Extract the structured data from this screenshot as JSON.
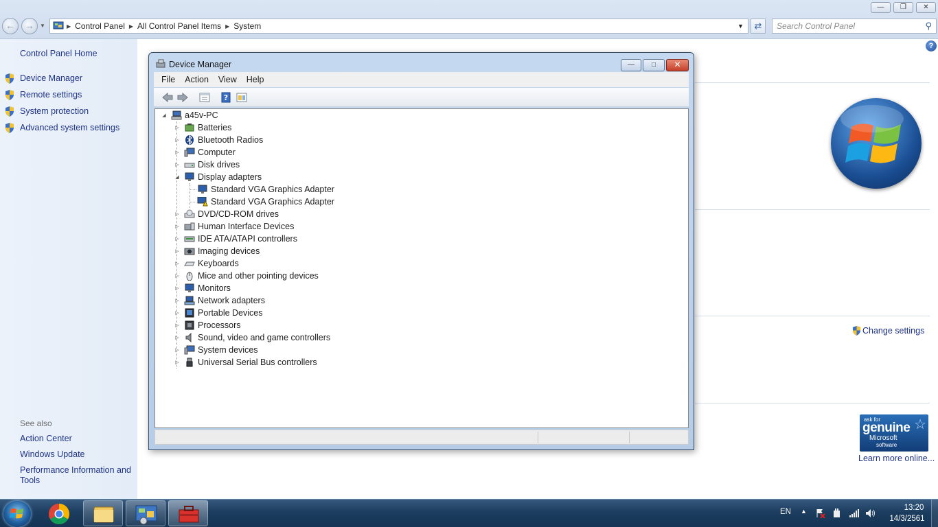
{
  "address": {
    "crumbs": [
      "Control Panel",
      "All Control Panel Items",
      "System"
    ]
  },
  "search": {
    "placeholder": "Search Control Panel"
  },
  "left_pane": {
    "home": "Control Panel Home",
    "tasks": [
      "Device Manager",
      "Remote settings",
      "System protection",
      "Advanced system settings"
    ],
    "see_also_title": "See also",
    "see_also": [
      "Action Center",
      "Windows Update",
      "Performance Information and Tools"
    ]
  },
  "right_pane": {
    "change_settings": "Change settings",
    "learn_more": "Learn more online...",
    "genuine": {
      "line1": "ask for",
      "line2": "genuine",
      "line3": "Microsoft",
      "line4": "software"
    }
  },
  "device_manager": {
    "title": "Device Manager",
    "menu": [
      "File",
      "Action",
      "View",
      "Help"
    ],
    "tree": [
      {
        "label": "a45v-PC",
        "level": 0,
        "expand": "open",
        "icon": "computer-icon"
      },
      {
        "label": "Batteries",
        "level": 1,
        "expand": "closed",
        "icon": "battery-icon"
      },
      {
        "label": "Bluetooth Radios",
        "level": 1,
        "expand": "closed",
        "icon": "bluetooth-icon"
      },
      {
        "label": "Computer",
        "level": 1,
        "expand": "closed",
        "icon": "computer-icon"
      },
      {
        "label": "Disk drives",
        "level": 1,
        "expand": "closed",
        "icon": "disk-drive-icon"
      },
      {
        "label": "Display adapters",
        "level": 1,
        "expand": "open",
        "icon": "monitor-icon"
      },
      {
        "label": "Standard VGA Graphics Adapter",
        "level": 2,
        "expand": "none",
        "icon": "monitor-icon"
      },
      {
        "label": "Standard VGA Graphics Adapter",
        "level": 2,
        "expand": "none",
        "icon": "monitor-warning-icon"
      },
      {
        "label": "DVD/CD-ROM drives",
        "level": 1,
        "expand": "closed",
        "icon": "dvd-drive-icon"
      },
      {
        "label": "Human Interface Devices",
        "level": 1,
        "expand": "closed",
        "icon": "hid-icon"
      },
      {
        "label": "IDE ATA/ATAPI controllers",
        "level": 1,
        "expand": "closed",
        "icon": "ide-controller-icon"
      },
      {
        "label": "Imaging devices",
        "level": 1,
        "expand": "closed",
        "icon": "camera-icon"
      },
      {
        "label": "Keyboards",
        "level": 1,
        "expand": "closed",
        "icon": "keyboard-icon"
      },
      {
        "label": "Mice and other pointing devices",
        "level": 1,
        "expand": "closed",
        "icon": "mouse-icon"
      },
      {
        "label": "Monitors",
        "level": 1,
        "expand": "closed",
        "icon": "monitor-icon"
      },
      {
        "label": "Network adapters",
        "level": 1,
        "expand": "closed",
        "icon": "network-icon"
      },
      {
        "label": "Portable Devices",
        "level": 1,
        "expand": "closed",
        "icon": "portable-device-icon"
      },
      {
        "label": "Processors",
        "level": 1,
        "expand": "closed",
        "icon": "processor-icon"
      },
      {
        "label": "Sound, video and game controllers",
        "level": 1,
        "expand": "closed",
        "icon": "speaker-icon"
      },
      {
        "label": "System devices",
        "level": 1,
        "expand": "closed",
        "icon": "system-device-icon"
      },
      {
        "label": "Universal Serial Bus controllers",
        "level": 1,
        "expand": "closed",
        "icon": "usb-icon"
      }
    ]
  },
  "taskbar": {
    "language": "EN",
    "time": "13:20",
    "date": "14/3/2561"
  },
  "colors": {
    "link": "#1e3287",
    "taskbar": "#1c3d5f",
    "window_frame": "#b6cde7"
  }
}
